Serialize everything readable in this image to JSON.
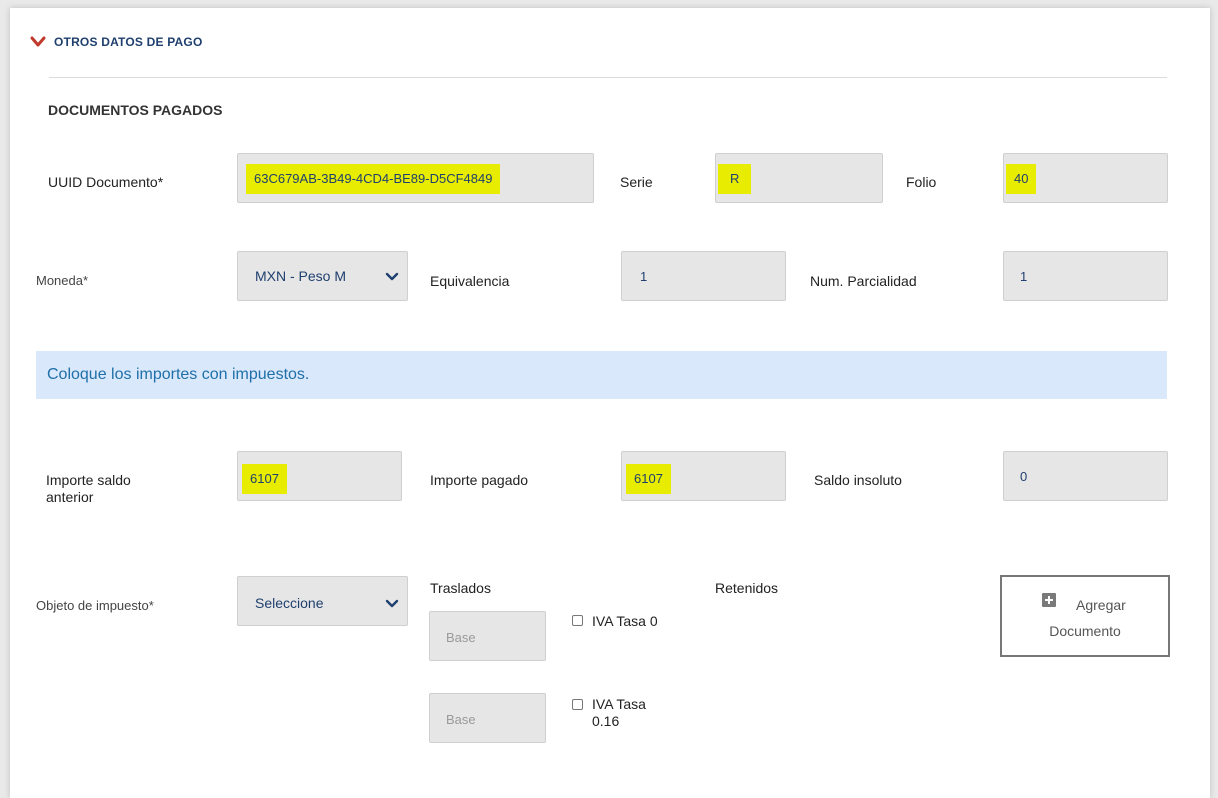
{
  "section": {
    "title": "OTROS DATOS DE PAGO"
  },
  "subsection": {
    "title": "DOCUMENTOS PAGADOS"
  },
  "row1": {
    "uuid_label": "UUID Documento*",
    "uuid_value": "63C679AB-3B49-4CD4-BE89-D5CF4849",
    "serie_label": "Serie",
    "serie_value": "R",
    "folio_label": "Folio",
    "folio_value": "40"
  },
  "row2": {
    "moneda_label": "Moneda*",
    "moneda_value": "MXN - Peso M",
    "equivalencia_label": "Equivalencia",
    "equivalencia_value": "1",
    "parcialidad_label": "Num. Parcialidad",
    "parcialidad_value": "1"
  },
  "banner": {
    "text": "Coloque los importes con impuestos."
  },
  "row3": {
    "saldo_anterior_label_1": "Importe saldo",
    "saldo_anterior_label_2": "anterior",
    "saldo_anterior_value": "6107",
    "pagado_label": "Importe pagado",
    "pagado_value": "6107",
    "insoluto_label": "Saldo insoluto",
    "insoluto_value": "0"
  },
  "row4": {
    "objeto_label": "Objeto de impuesto*",
    "objeto_value": "Seleccione",
    "traslados_label": "Traslados",
    "retenidos_label": "Retenidos",
    "base_placeholder": "Base",
    "iva0_label": "IVA Tasa 0",
    "iva16_label_1": "IVA Tasa",
    "iva16_label_2": "0.16",
    "add_button_line1": "Agregar",
    "add_button_line2": "Documento"
  },
  "colors": {
    "highlight": "#e8ec00",
    "banner_bg": "#d9e8fb",
    "banner_text": "#1f6fa8",
    "value_text": "#1f3f6e",
    "chevron": "#c0392b"
  },
  "icons": {
    "section_toggle": "chevron-down-icon",
    "select_caret": "chevron-down-icon",
    "add_document": "plus-square-icon"
  }
}
